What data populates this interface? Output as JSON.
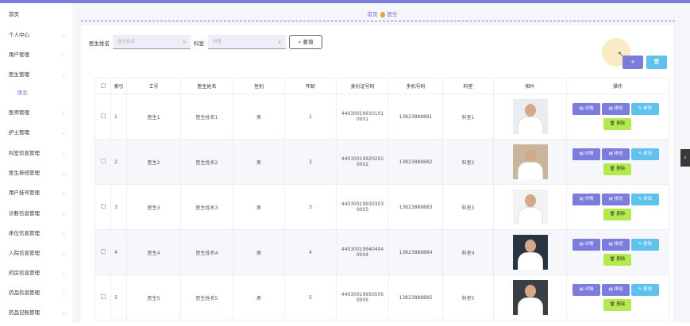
{
  "sidebar": {
    "items": [
      {
        "label": "首页",
        "chevron": ""
      },
      {
        "label": "个人中心",
        "chevron": "⌄"
      },
      {
        "label": "用户管理",
        "chevron": "⌄"
      },
      {
        "label": "医生管理",
        "chevron": "⌄"
      },
      {
        "label": "医生",
        "chevron": ""
      },
      {
        "label": "医师管理",
        "chevron": "⌄"
      },
      {
        "label": "护士管理",
        "chevron": "⌄"
      },
      {
        "label": "科室信息管理",
        "chevron": "⌄"
      },
      {
        "label": "医生排班管理",
        "chevron": "⌄"
      },
      {
        "label": "用户挂号管理",
        "chevron": "⌄"
      },
      {
        "label": "诊断信息管理",
        "chevron": "⌄"
      },
      {
        "label": "床位信息管理",
        "chevron": "⌄"
      },
      {
        "label": "入院信息管理",
        "chevron": "⌄"
      },
      {
        "label": "药房信息管理",
        "chevron": "⌄"
      },
      {
        "label": "药品信息管理",
        "chevron": "⌄"
      },
      {
        "label": "药品记账管理",
        "chevron": "⌄"
      }
    ]
  },
  "breadcrumb": {
    "home": "首页",
    "current": "医生"
  },
  "search": {
    "doctor_name_label": "医生姓名",
    "doctor_name_placeholder": "医生姓名",
    "dept_label": "科室",
    "dept_placeholder": "科室",
    "query_label": "查询",
    "search_icon": "⌕"
  },
  "actions": {
    "add_label": "+",
    "delete_label": "🗑"
  },
  "table": {
    "headers": [
      "索引",
      "工号",
      "医生姓名",
      "性别",
      "年龄",
      "身份证号码",
      "手机号码",
      "科室",
      "相片",
      "操作"
    ],
    "rows": [
      {
        "index": "1",
        "id": "医生1",
        "name": "医生姓名1",
        "gender": "男",
        "age": "1",
        "idcard1": "44030019910101",
        "idcard2": "0001",
        "phone": "13823888881",
        "dept": "科室1"
      },
      {
        "index": "2",
        "id": "医生2",
        "name": "医生姓名2",
        "gender": "男",
        "age": "2",
        "idcard1": "44030019920202",
        "idcard2": "0002",
        "phone": "13823888882",
        "dept": "科室2"
      },
      {
        "index": "3",
        "id": "医生3",
        "name": "医生姓名3",
        "gender": "男",
        "age": "3",
        "idcard1": "44030019930303",
        "idcard2": "0003",
        "phone": "13823888883",
        "dept": "科室3"
      },
      {
        "index": "4",
        "id": "医生4",
        "name": "医生姓名4",
        "gender": "男",
        "age": "4",
        "idcard1": "44030019940404",
        "idcard2": "0004",
        "phone": "13823888884",
        "dept": "科室4"
      },
      {
        "index": "5",
        "id": "医生5",
        "name": "医生姓名5",
        "gender": "男",
        "age": "5",
        "idcard1": "44030019950505",
        "idcard2": "0005",
        "phone": "13823888885",
        "dept": "科室5"
      }
    ],
    "op_labels": {
      "detail": "详情",
      "schedule": "排班",
      "edit": "修改",
      "delete": "删除"
    }
  },
  "colors": {
    "accent": "#7b7cdc",
    "info": "#5ec2ec",
    "danger_btn": "#b5ea4c"
  }
}
